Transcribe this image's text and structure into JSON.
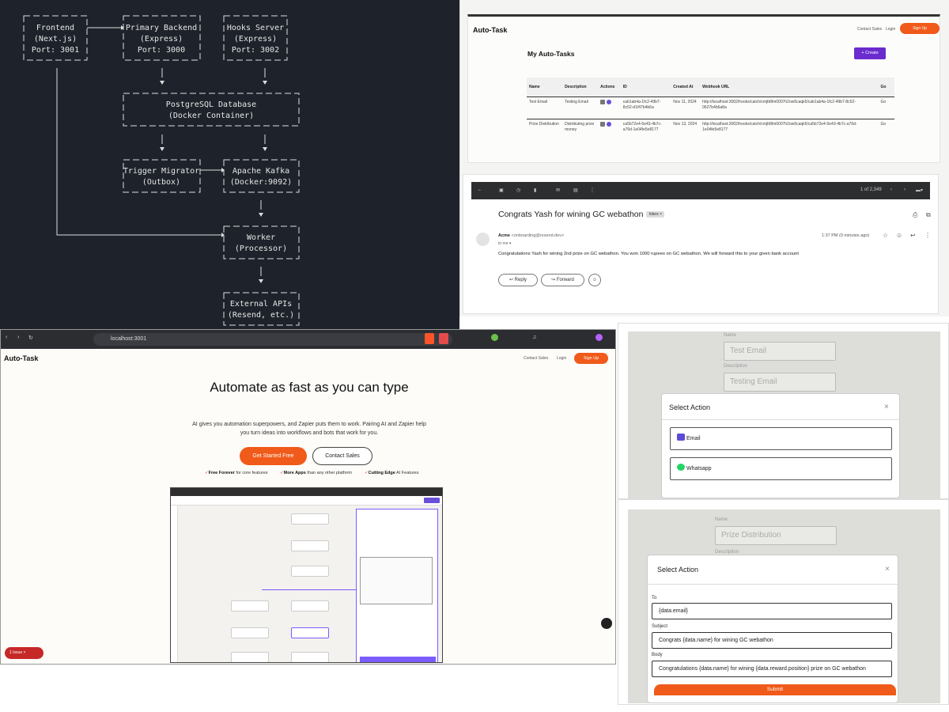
{
  "architecture": {
    "nodes": [
      {
        "id": "frontend",
        "lines": [
          "Frontend",
          "(Next.js)",
          "Port: 3001"
        ]
      },
      {
        "id": "backend",
        "lines": [
          "Primary Backend",
          "(Express)",
          "Port: 3000"
        ]
      },
      {
        "id": "hooks",
        "lines": [
          "Hooks Server",
          "(Express)",
          "Port: 3002"
        ]
      },
      {
        "id": "postgres",
        "lines": [
          "PostgreSQL Database",
          "(Docker Container)"
        ]
      },
      {
        "id": "migrator",
        "lines": [
          "Trigger Migrator",
          "(Outbox)"
        ]
      },
      {
        "id": "kafka",
        "lines": [
          "Apache Kafka",
          "(Docker:9092)"
        ]
      },
      {
        "id": "worker",
        "lines": [
          "Worker",
          "(Processor)"
        ]
      },
      {
        "id": "external",
        "lines": [
          "External APIs",
          "(Resend, etc.)"
        ]
      }
    ]
  },
  "tasks": {
    "brand": "Auto-Task",
    "nav": {
      "contact": "Contact Sales",
      "login": "Login",
      "signup": "Sign Up"
    },
    "title": "My Auto-Tasks",
    "create_label": "+ Create",
    "columns": [
      "Name",
      "Description",
      "Actions",
      "ID",
      "Created At",
      "Webhook URL",
      "Go"
    ],
    "rows": [
      {
        "name": "Test Email",
        "description": "Testing Email",
        "id": "cab1ab4a-1fc2-49b7-8c52-d1f47b4b6a",
        "created": "Nov 11, 2024",
        "url": "http://localhost:3002/hooks/catch/cmjfd8m0007h2ow5caqk5/cab1ab4a-1fc2-49b7-8c52-0627b4b6a8a",
        "go": "Go"
      },
      {
        "name": "Prize Distribution",
        "description": "Distributing prize money",
        "id": "ca5b72e4-5e43-4b7c-a76d-1e04fe5e8177",
        "created": "Nov 13, 2024",
        "url": "http://localhost:3002/hooks/catch/cmjfd8m0007h2ow5caqk5/ca5b72e4-5e43-4b7c-a76d-1e04fe5e8177",
        "go": "Go"
      }
    ]
  },
  "email": {
    "counter": "1 of 2,349",
    "subject": "Congrats Yash for wining GC webathon",
    "inbox_label": "Inbox ×",
    "from_name": "Acme",
    "from_addr": "<onboarding@resend.dev>",
    "to": "to me ▾",
    "time": "1:37 PM (0 minutes ago)",
    "body": "Congratulations Yash for wining 2nd prize on GC webathon. You won 1000 rupees on GC webathon. We will forward this to your given bank account",
    "reply": "Reply",
    "forward": "Forward"
  },
  "landing": {
    "url": "localhost:3001",
    "brand": "Auto-Task",
    "nav": {
      "contact": "Contact Sales",
      "login": "Login",
      "signup": "Sign Up"
    },
    "hero": "Automate as fast as you can type",
    "subtitle": "AI gives you automation superpowers, and Zapier puts them to work. Pairing AI and Zapier help you turn ideas into workflows and bots that work for you.",
    "cta_primary": "Get Started Free",
    "cta_secondary": "Contact Sales",
    "features": [
      {
        "bold": "Free Forever",
        "rest": " for core features"
      },
      {
        "bold": "More Apps",
        "rest": " than any other platform"
      },
      {
        "bold": "Cutting Edge",
        "rest": " AI Features"
      }
    ],
    "issues_label": "1 Issue"
  },
  "email_modal": {
    "name_label": "Name",
    "name_value": "Test Email",
    "desc_label": "Description",
    "desc_value": "Testing Email",
    "title": "Select Action",
    "close": "×",
    "options": [
      {
        "label": "Email",
        "color": "#5b4bd6"
      },
      {
        "label": "Whatsapp",
        "color": "#25d366"
      }
    ]
  },
  "prize_modal": {
    "name_label": "Name",
    "name_value": "Prize Distribution",
    "desc_label": "Description",
    "title": "Select Action",
    "close": "×",
    "to_label": "To",
    "to_value": "{data.email}",
    "subject_label": "Subject",
    "subject_value": "Congrats {data.name} for wining GC webathon",
    "body_label": "Body",
    "body_value": "Congratulations {data.name} for wining {data.reward.position} prize on GC webathon",
    "submit": "Submit"
  },
  "colors": {
    "accent": "#f05a1a",
    "purple": "#6a2ccf",
    "diagram_bg": "#1e232b"
  }
}
